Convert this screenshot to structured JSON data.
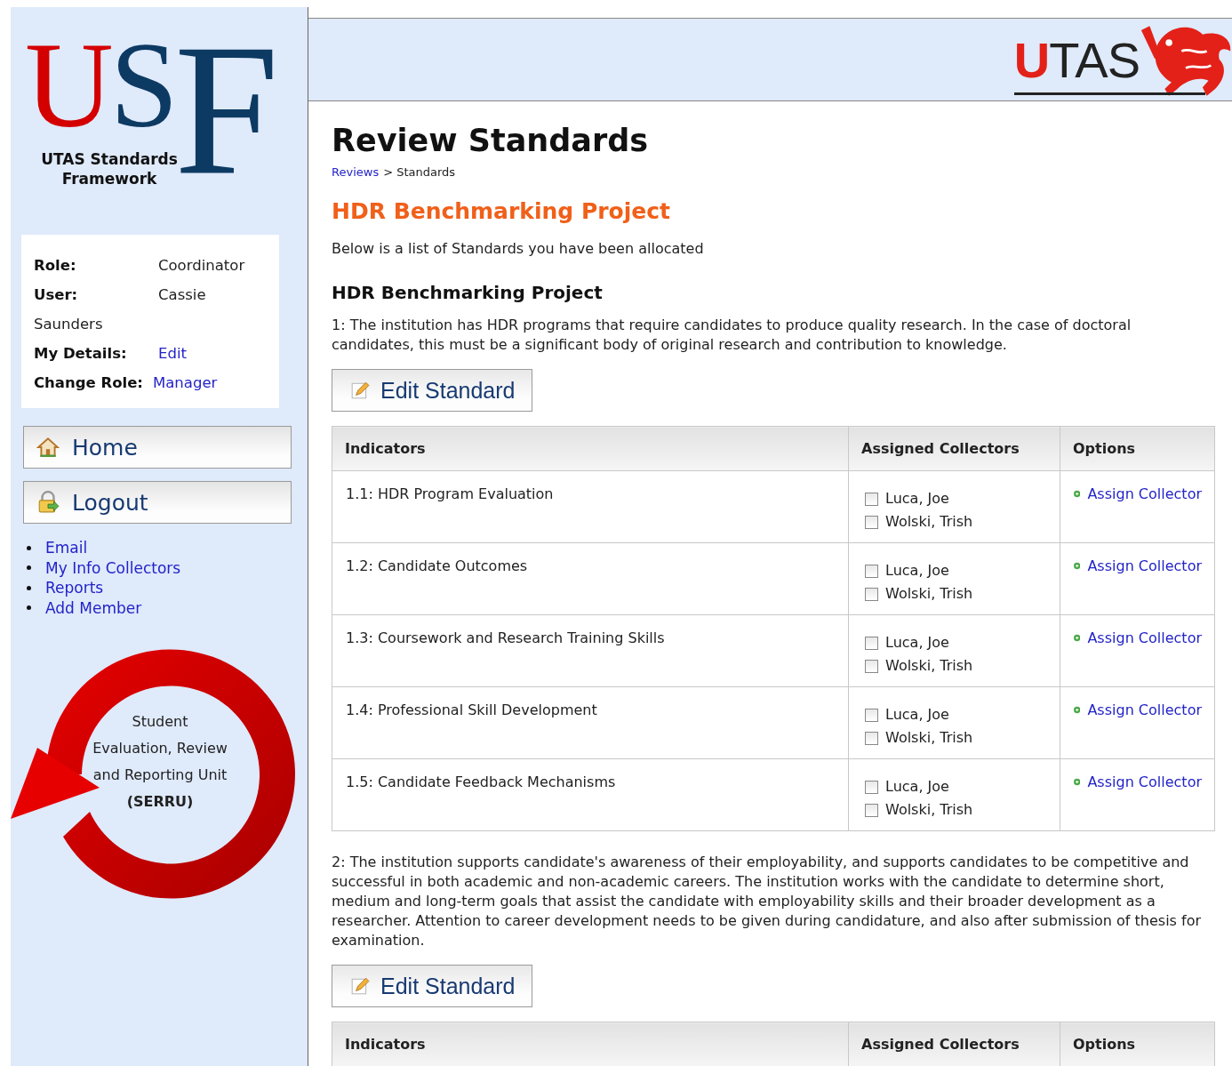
{
  "logo": {
    "letters": [
      "U",
      "S",
      "F"
    ],
    "subtitle": "UTAS Standards Framework"
  },
  "user_panel": [
    {
      "label": "Role:",
      "value": "Coordinator",
      "kind": "text"
    },
    {
      "label": "User:",
      "value": "Cassie Saunders",
      "kind": "text"
    },
    {
      "label": "My Details:",
      "value": "Edit",
      "kind": "link"
    },
    {
      "label": "Change Role:",
      "value": "Manager",
      "kind": "link"
    }
  ],
  "nav_buttons": [
    {
      "label": "Home",
      "kind": "home"
    },
    {
      "label": "Logout",
      "kind": "logout"
    }
  ],
  "links": [
    "Email",
    "My Info Collectors",
    "Reports",
    "Add Member"
  ],
  "serru": {
    "lines": [
      "Student",
      "Evaluation, Review",
      "and Reporting Unit"
    ],
    "acronym": "(SERRU)"
  },
  "header_logo": "UTAS",
  "page": {
    "title": "Review Standards",
    "breadcrumb": {
      "link": "Reviews",
      "rest": "> Standards"
    },
    "project_title": "HDR Benchmarking Project",
    "intro": "Below is a list of Standards you have been allocated",
    "project_heading": "HDR Benchmarking Project",
    "standards": [
      {
        "text": "1: The institution has HDR programs that require candidates to produce quality research. In the case of doctoral candidates, this must be a significant body of original research and contribution to knowledge.",
        "button": "Edit Standard",
        "table": {
          "columns": [
            "Indicators",
            "Assigned Collectors",
            "Options"
          ],
          "rows": [
            {
              "indicator": "1.1: HDR Program Evaluation",
              "collectors": [
                {
                  "name": "Luca, Joe",
                  "checked": false
                },
                {
                  "name": "Wolski, Trish",
                  "checked": false
                }
              ],
              "option": "Assign Collector"
            },
            {
              "indicator": "1.2: Candidate Outcomes",
              "collectors": [
                {
                  "name": "Luca, Joe",
                  "checked": false
                },
                {
                  "name": "Wolski, Trish",
                  "checked": false
                }
              ],
              "option": "Assign Collector"
            },
            {
              "indicator": "1.3: Coursework and Research Training Skills",
              "collectors": [
                {
                  "name": "Luca, Joe",
                  "checked": false
                },
                {
                  "name": "Wolski, Trish",
                  "checked": false
                }
              ],
              "option": "Assign Collector"
            },
            {
              "indicator": "1.4: Professional Skill Development",
              "collectors": [
                {
                  "name": "Luca, Joe",
                  "checked": false
                },
                {
                  "name": "Wolski, Trish",
                  "checked": false
                }
              ],
              "option": "Assign Collector"
            },
            {
              "indicator": "1.5: Candidate Feedback Mechanisms",
              "collectors": [
                {
                  "name": "Luca, Joe",
                  "checked": false
                },
                {
                  "name": "Wolski, Trish",
                  "checked": false
                }
              ],
              "option": "Assign Collector"
            }
          ]
        }
      },
      {
        "text": "2: The institution supports candidate's awareness of their employability, and supports candidates to be competitive and successful in both academic and non-academic careers. The institution works with the candidate to determine short, medium and long-term goals that assist the candidate with employability skills and their broader development as a researcher. Attention to career development needs to be given during candidature, and also after submission of thesis for examination.",
        "button": "Edit Standard",
        "table": {
          "columns": [
            "Indicators",
            "Assigned Collectors",
            "Options"
          ]
        }
      }
    ]
  }
}
